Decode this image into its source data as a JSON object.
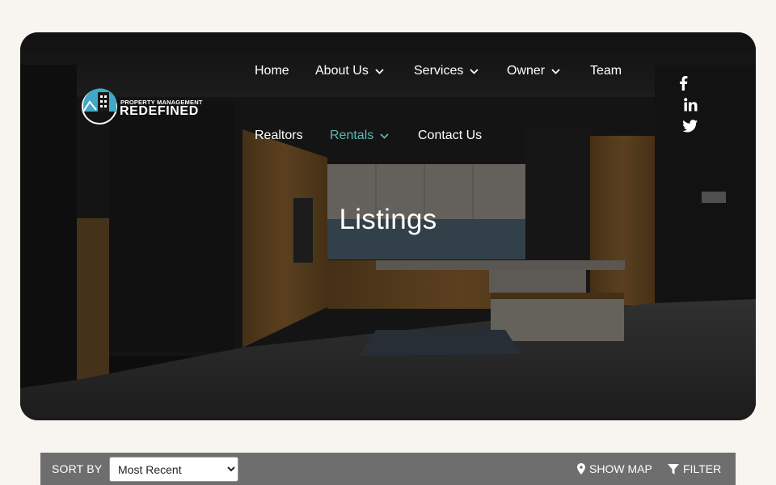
{
  "header": {
    "logo": {
      "line1": "PROPERTY MANAGEMENT",
      "line2": "REDEFINED"
    },
    "nav": [
      {
        "label": "Home",
        "has_dropdown": false,
        "active": false
      },
      {
        "label": "About Us",
        "has_dropdown": true,
        "active": false
      },
      {
        "label": "Services",
        "has_dropdown": true,
        "active": false
      },
      {
        "label": "Owner",
        "has_dropdown": true,
        "active": false
      },
      {
        "label": "Team",
        "has_dropdown": false,
        "active": false
      },
      {
        "label": "Realtors",
        "has_dropdown": false,
        "active": false
      },
      {
        "label": "Rentals",
        "has_dropdown": true,
        "active": true
      },
      {
        "label": "Contact Us",
        "has_dropdown": false,
        "active": false
      }
    ],
    "social": [
      "facebook-icon",
      "linkedin-icon",
      "twitter-icon"
    ]
  },
  "hero": {
    "title": "Listings"
  },
  "toolbar": {
    "sort_label": "SORT BY",
    "sort_selected": "Most Recent",
    "show_map_label": "SHOW MAP",
    "filter_label": "FILTER"
  },
  "colors": {
    "active_nav": "#5fb8b2",
    "toolbar_bg": "#6e6e6e",
    "page_bg": "#f8f5f1"
  }
}
